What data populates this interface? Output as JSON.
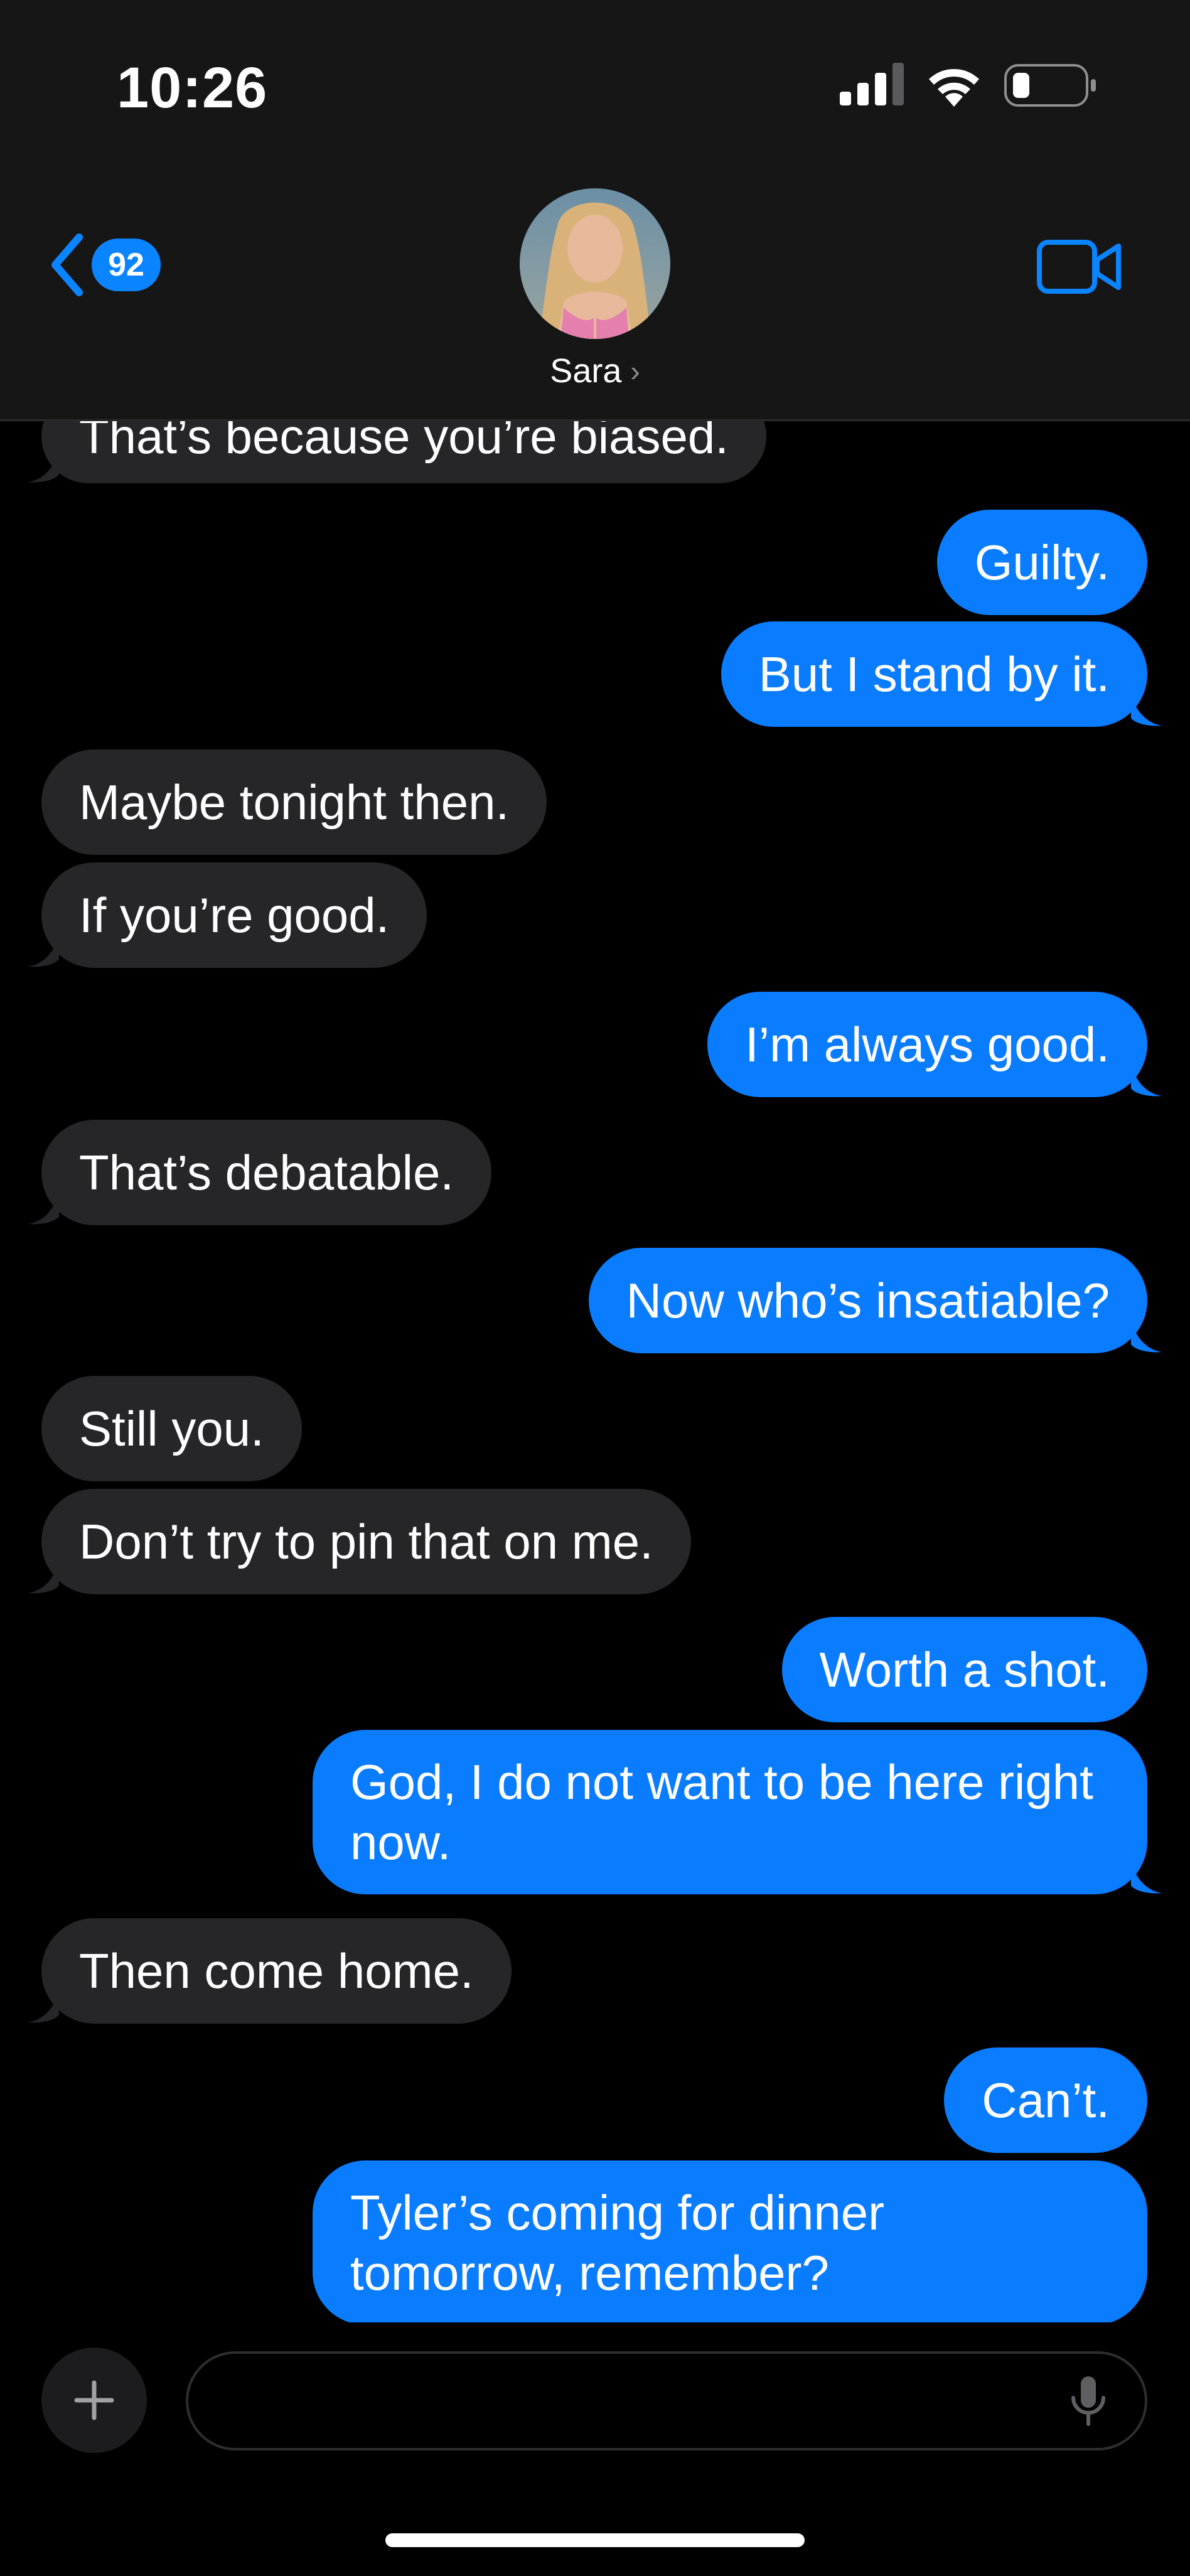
{
  "status_bar": {
    "time": "10:26"
  },
  "header": {
    "back_badge_count": "92",
    "contact_name": "Sara",
    "chevron": "›"
  },
  "messages": [
    {
      "side": "in",
      "text": "That’s because you’re biased."
    },
    {
      "side": "out",
      "text": "Guilty."
    },
    {
      "side": "out",
      "text": "But I stand by it."
    },
    {
      "side": "in",
      "text": "Maybe tonight then."
    },
    {
      "side": "in",
      "text": "If you’re good."
    },
    {
      "side": "out",
      "text": "I’m always good."
    },
    {
      "side": "in",
      "text": "That’s debatable."
    },
    {
      "side": "out",
      "text": "Now who’s insatiable?"
    },
    {
      "side": "in",
      "text": "Still you."
    },
    {
      "side": "in",
      "text": "Don’t try to pin that on me."
    },
    {
      "side": "out",
      "text": "Worth a shot."
    },
    {
      "side": "out",
      "text": "God, I do not want to be here right now."
    },
    {
      "side": "in",
      "text": "Then come home."
    },
    {
      "side": "out",
      "text": "Can’t."
    },
    {
      "side": "out",
      "text": "Tyler’s coming for dinner tomorrow, remember?"
    }
  ],
  "composer": {
    "placeholder": "",
    "value": ""
  },
  "icons": {
    "back": "chevron-left-icon",
    "video": "video-camera-icon",
    "add": "plus-icon",
    "mic": "microphone-icon"
  },
  "colors": {
    "accent": "#0a84ff",
    "outgoing_bubble": "#0a7cff",
    "incoming_bubble": "#262628",
    "header_bg": "#161616"
  }
}
